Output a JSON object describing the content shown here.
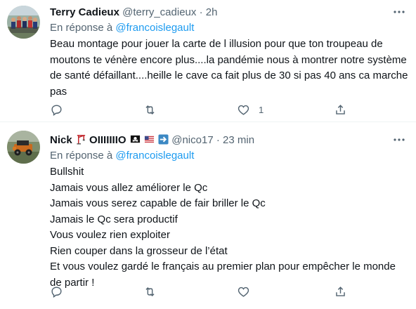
{
  "tweets": [
    {
      "name": "Terry Cadieux",
      "handle": "@terry_cadieux",
      "time": "2h",
      "reply_label": "En réponse à",
      "reply_to": "@francoislegault",
      "text": "Beau montage pour jouer la carte de l illusion pour que ton troupeau de moutons te vénère encore plus....la pandémie nous à montrer notre système de santé défaillant....heille le cave ca fait plus de 30 si pas 40 ans ca marche pas",
      "like_count": "1",
      "avatar_icon": "group-photo-avatar"
    },
    {
      "name": "Nick",
      "name_suffix": "OIIIIIIIO",
      "handle": "@nico17",
      "time": "23 min",
      "reply_label": "En réponse à",
      "reply_to": "@francoislegault",
      "lines": [
        "Bullshit",
        "Jamais vous allez améliorer le Qc",
        "Jamais vous serez capable de fair briller le Qc",
        "Jamais le Qc sera productif",
        "Vous voulez rien exploiter",
        "Rien couper dans la grosseur de l’état",
        "Et vous voulez gardé le français au premier plan pour empêcher le monde de partir !"
      ],
      "avatar_icon": "jeep-photo-avatar",
      "name_icons": [
        "crane-emoji-icon",
        "pirate-flag-emoji-icon",
        "us-flag-emoji-icon",
        "right-arrow-emoji-icon"
      ]
    }
  ],
  "dot": "·",
  "colors": {
    "link": "#1d9bf0",
    "secondary": "#536471",
    "text": "#0f1419"
  }
}
